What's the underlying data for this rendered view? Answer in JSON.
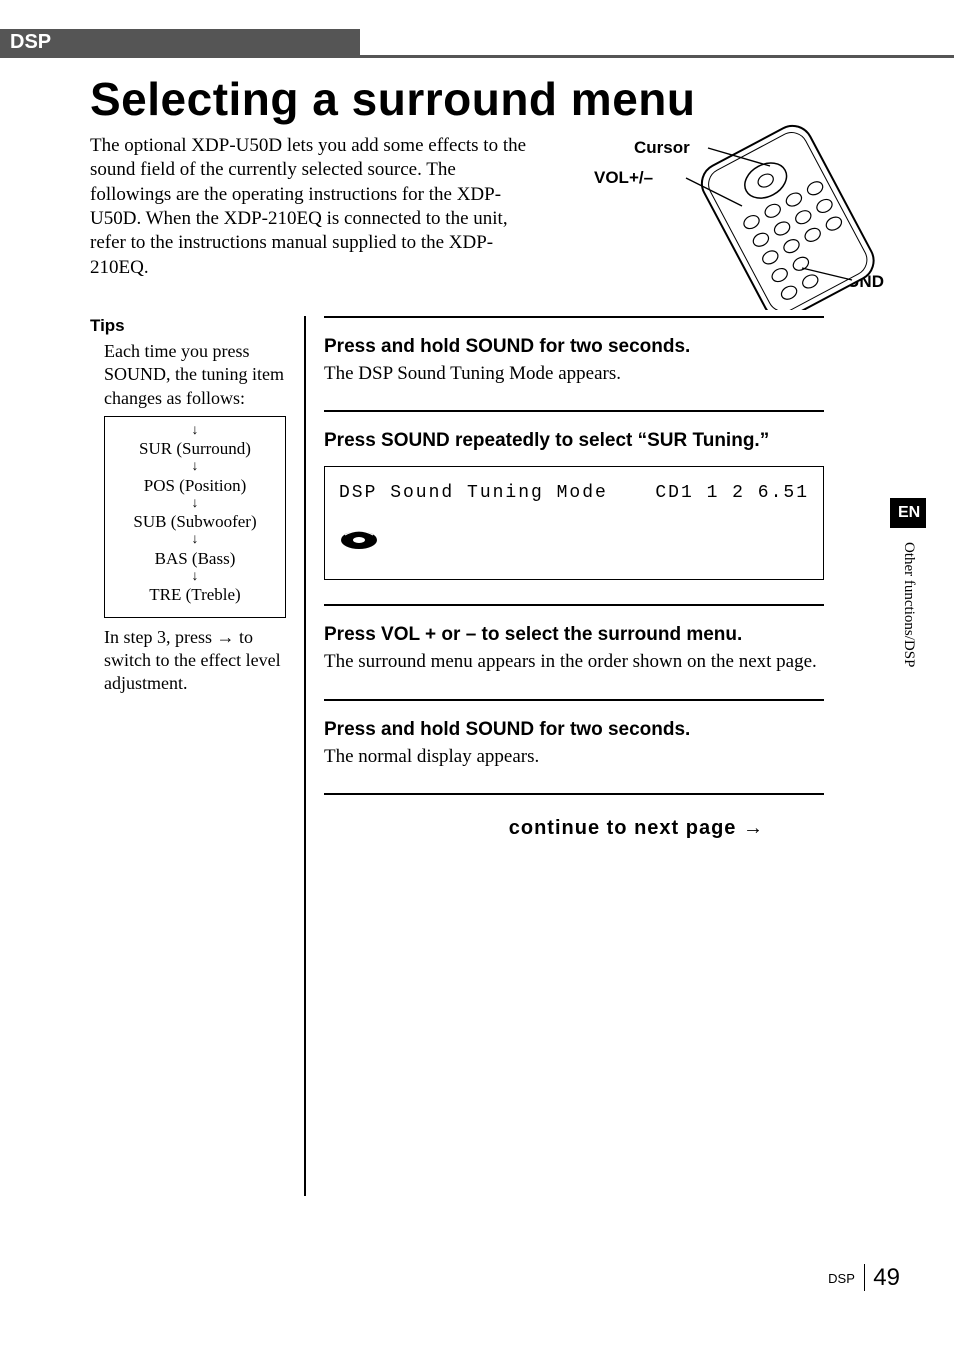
{
  "header": {
    "tab": "DSP"
  },
  "title": "Selecting a surround menu",
  "intro": "The optional XDP-U50D lets you add some effects to the sound field of the currently selected source. The followings are the operating instructions for the XDP-U50D.\nWhen the XDP-210EQ is connected to the unit, refer to the instructions manual supplied to the XDP-210EQ.",
  "remote": {
    "cursor": "Cursor",
    "vol": "VOL+/–",
    "sound": "SOUND"
  },
  "tips": {
    "heading": "Tips",
    "body": "Each time you press SOUND, the tuning item changes as follows:",
    "flow": [
      "SUR (Surround)",
      "POS (Position)",
      "SUB (Subwoofer)",
      "BAS (Bass)",
      "TRE (Treble)"
    ],
    "note": "In step 3, press → to switch to the effect level adjustment."
  },
  "steps": [
    {
      "h": "Press and hold SOUND for two seconds.",
      "b": "The DSP Sound Tuning Mode appears."
    },
    {
      "h": "Press SOUND repeatedly to select “SUR Tuning.”",
      "b": "",
      "lcd": {
        "left": "DSP Sound Tuning Mode",
        "right": "CD1 1 2  6.51"
      }
    },
    {
      "h": "Press VOL + or – to select the surround menu.",
      "b": "The surround menu appears in the order shown on the next page."
    },
    {
      "h": "Press and hold SOUND for two seconds.",
      "b": "The normal display appears."
    }
  ],
  "continue": "continue to next page →",
  "side": {
    "lang": "EN",
    "section": "Other functions/DSP"
  },
  "footer": {
    "section": "DSP",
    "page": "49"
  }
}
